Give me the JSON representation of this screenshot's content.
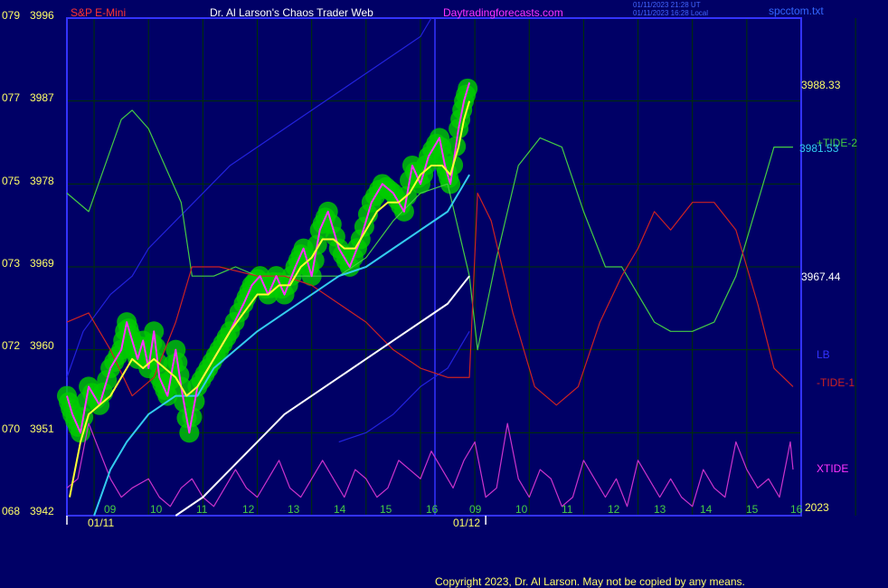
{
  "header": {
    "instrument": "S&P E-Mini",
    "author": "Dr. Al Larson's Chaos Trader Web",
    "website": "Daytradingforecasts.com",
    "timestamp_utc": "01/11/2023 21:28 UT",
    "timestamp_local": "01/11/2023 16:28 Local",
    "filename": "spcctom.txt"
  },
  "footer": {
    "copyright": "Copyright 2023, Dr. Al Larson. May not be copied by any means."
  },
  "right_labels": {
    "price_high": "3988.33",
    "price_mid": "3981.53",
    "price_low": "3967.44",
    "tide2": "+TIDE-2",
    "lb": "LB",
    "tide1": "-TIDE-1",
    "xtide": "XTIDE",
    "year": "2023"
  },
  "colors": {
    "background": "#000066",
    "frame": "#3333ff",
    "grid": "#003300",
    "price": "#ff33ff",
    "smooth": "#ffff33",
    "cyan": "#33ccee",
    "tide2": "#44cc44",
    "tide1": "#cc2222",
    "lb": "#2222dd",
    "xtide": "#cc33cc",
    "white_line": "#ffffff",
    "energy": "#00cc00"
  },
  "chart_data": {
    "type": "line",
    "title": "S&P E-Mini",
    "y_axis": {
      "range": [
        3942,
        3996
      ],
      "ticks": [
        {
          "left": "079",
          "right": "3996"
        },
        {
          "left": "077",
          "right": "3987"
        },
        {
          "left": "075",
          "right": "3978"
        },
        {
          "left": "073",
          "right": "3969"
        },
        {
          "left": "072",
          "right": "3960"
        },
        {
          "left": "070",
          "right": "3951"
        },
        {
          "left": "068",
          "right": "3942"
        }
      ]
    },
    "x_axis": {
      "hour_labels": [
        "09",
        "10",
        "11",
        "12",
        "13",
        "14",
        "15",
        "16",
        "09",
        "10",
        "11",
        "12",
        "13",
        "14",
        "15",
        "16"
      ],
      "date_labels": [
        "01/11",
        "01/12"
      ],
      "grid": true
    },
    "series": [
      {
        "key": "price",
        "points": [
          [
            8.5,
            3955
          ],
          [
            8.6,
            3953
          ],
          [
            8.75,
            3951
          ],
          [
            8.9,
            3956
          ],
          [
            9.1,
            3954
          ],
          [
            9.3,
            3958
          ],
          [
            9.5,
            3960
          ],
          [
            9.6,
            3963
          ],
          [
            9.7,
            3961
          ],
          [
            9.8,
            3959
          ],
          [
            9.9,
            3961
          ],
          [
            10.0,
            3958
          ],
          [
            10.1,
            3962
          ],
          [
            10.2,
            3957
          ],
          [
            10.35,
            3955
          ],
          [
            10.5,
            3960
          ],
          [
            10.6,
            3956
          ],
          [
            10.75,
            3951
          ],
          [
            10.9,
            3956
          ],
          [
            11.1,
            3958
          ],
          [
            11.3,
            3960
          ],
          [
            11.5,
            3962
          ],
          [
            11.75,
            3965
          ],
          [
            11.9,
            3967
          ],
          [
            12.05,
            3968
          ],
          [
            12.2,
            3966
          ],
          [
            12.35,
            3968
          ],
          [
            12.5,
            3966
          ],
          [
            12.7,
            3969
          ],
          [
            12.85,
            3971
          ],
          [
            13.0,
            3968
          ],
          [
            13.15,
            3973
          ],
          [
            13.3,
            3975
          ],
          [
            13.5,
            3971
          ],
          [
            13.7,
            3969
          ],
          [
            13.9,
            3972
          ],
          [
            14.1,
            3976
          ],
          [
            14.3,
            3978
          ],
          [
            14.5,
            3977
          ],
          [
            14.7,
            3975
          ],
          [
            14.85,
            3980
          ],
          [
            15.0,
            3978
          ],
          [
            15.15,
            3981
          ],
          [
            15.35,
            3983
          ],
          [
            15.45,
            3980
          ],
          [
            15.55,
            3978
          ],
          [
            15.7,
            3984
          ],
          [
            15.8,
            3987
          ],
          [
            15.9,
            3989
          ]
        ]
      },
      {
        "key": "smooth",
        "points": [
          [
            8.55,
            3944
          ],
          [
            8.75,
            3950
          ],
          [
            8.9,
            3953
          ],
          [
            9.1,
            3954
          ],
          [
            9.3,
            3955
          ],
          [
            9.5,
            3957
          ],
          [
            9.7,
            3959
          ],
          [
            9.9,
            3958
          ],
          [
            10.1,
            3959
          ],
          [
            10.3,
            3958
          ],
          [
            10.5,
            3957
          ],
          [
            10.7,
            3955
          ],
          [
            10.9,
            3956
          ],
          [
            11.1,
            3958
          ],
          [
            11.3,
            3960
          ],
          [
            11.5,
            3962
          ],
          [
            11.75,
            3964
          ],
          [
            12.0,
            3966
          ],
          [
            12.2,
            3966
          ],
          [
            12.4,
            3967
          ],
          [
            12.6,
            3967
          ],
          [
            12.8,
            3969
          ],
          [
            13.0,
            3970
          ],
          [
            13.2,
            3972
          ],
          [
            13.4,
            3972
          ],
          [
            13.6,
            3971
          ],
          [
            13.8,
            3971
          ],
          [
            14.0,
            3973
          ],
          [
            14.2,
            3975
          ],
          [
            14.4,
            3976
          ],
          [
            14.6,
            3976
          ],
          [
            14.8,
            3977
          ],
          [
            15.0,
            3979
          ],
          [
            15.2,
            3980
          ],
          [
            15.4,
            3980
          ],
          [
            15.55,
            3979
          ],
          [
            15.7,
            3982
          ],
          [
            15.8,
            3985
          ],
          [
            15.9,
            3987
          ]
        ]
      },
      {
        "key": "cyan",
        "points": [
          [
            9.0,
            3942
          ],
          [
            9.3,
            3947
          ],
          [
            9.6,
            3950
          ],
          [
            10.0,
            3953
          ],
          [
            10.5,
            3955
          ],
          [
            10.9,
            3955
          ],
          [
            11.2,
            3958
          ],
          [
            11.6,
            3960
          ],
          [
            12.0,
            3962
          ],
          [
            12.5,
            3964
          ],
          [
            13.0,
            3966
          ],
          [
            13.5,
            3968
          ],
          [
            14.0,
            3969
          ],
          [
            14.5,
            3971
          ],
          [
            15.0,
            3973
          ],
          [
            15.5,
            3975
          ],
          [
            15.9,
            3979
          ]
        ]
      },
      {
        "key": "white",
        "points": [
          [
            10.5,
            3942
          ],
          [
            11.0,
            3944
          ],
          [
            11.5,
            3947
          ],
          [
            12.0,
            3950
          ],
          [
            12.5,
            3953
          ],
          [
            13.0,
            3955
          ],
          [
            13.5,
            3957
          ],
          [
            14.0,
            3959
          ],
          [
            14.5,
            3961
          ],
          [
            15.0,
            3963
          ],
          [
            15.5,
            3965
          ],
          [
            15.9,
            3968
          ]
        ]
      },
      {
        "key": "lb",
        "points": [
          [
            8.5,
            3957
          ],
          [
            8.8,
            3962
          ],
          [
            9.3,
            3966
          ],
          [
            9.7,
            3968
          ],
          [
            10.0,
            3971
          ],
          [
            10.5,
            3974
          ],
          [
            11.0,
            3977
          ],
          [
            11.5,
            3980
          ],
          [
            12.0,
            3982
          ],
          [
            12.5,
            3984
          ],
          [
            13.0,
            3986
          ],
          [
            13.5,
            3988
          ],
          [
            14.0,
            3990
          ],
          [
            14.5,
            3992
          ],
          [
            15.0,
            3994
          ],
          [
            15.2,
            3996
          ]
        ],
        "end_points": [
          [
            13.5,
            3950
          ],
          [
            14.0,
            3951
          ],
          [
            14.5,
            3953
          ],
          [
            15.0,
            3956
          ],
          [
            15.5,
            3958
          ],
          [
            15.9,
            3962
          ]
        ]
      },
      {
        "key": "tide2",
        "points": [
          [
            8.5,
            3977
          ],
          [
            8.9,
            3975
          ],
          [
            9.2,
            3980
          ],
          [
            9.5,
            3985
          ],
          [
            9.7,
            3986
          ],
          [
            10.0,
            3984
          ],
          [
            10.3,
            3980
          ],
          [
            10.6,
            3976
          ],
          [
            10.8,
            3968
          ],
          [
            11.2,
            3968
          ],
          [
            11.6,
            3969
          ],
          [
            12.0,
            3968
          ],
          [
            12.5,
            3968
          ],
          [
            13.0,
            3968
          ],
          [
            13.5,
            3968
          ],
          [
            14.0,
            3970
          ],
          [
            14.5,
            3974
          ],
          [
            15.0,
            3977
          ],
          [
            15.5,
            3978
          ],
          [
            15.9,
            3968
          ],
          [
            16.05,
            3960
          ],
          [
            16.4,
            3970
          ],
          [
            16.8,
            3980
          ],
          [
            17.2,
            3983
          ],
          [
            17.6,
            3982
          ],
          [
            18.0,
            3975
          ],
          [
            18.4,
            3969
          ],
          [
            18.7,
            3969
          ],
          [
            19.0,
            3966
          ],
          [
            19.3,
            3963
          ],
          [
            19.6,
            3962
          ],
          [
            20.0,
            3962
          ],
          [
            20.4,
            3963
          ],
          [
            20.8,
            3968
          ],
          [
            21.2,
            3976
          ],
          [
            21.5,
            3982
          ],
          [
            21.85,
            3982
          ]
        ]
      },
      {
        "key": "tide1",
        "points": [
          [
            8.5,
            3963
          ],
          [
            8.9,
            3964
          ],
          [
            9.3,
            3960
          ],
          [
            9.7,
            3955
          ],
          [
            10.1,
            3957
          ],
          [
            10.5,
            3963
          ],
          [
            10.8,
            3969
          ],
          [
            11.3,
            3969
          ],
          [
            12.0,
            3968
          ],
          [
            12.5,
            3968
          ],
          [
            13.0,
            3967
          ],
          [
            13.5,
            3965
          ],
          [
            14.0,
            3963
          ],
          [
            14.5,
            3960
          ],
          [
            15.0,
            3958
          ],
          [
            15.5,
            3957
          ],
          [
            15.9,
            3957
          ],
          [
            16.05,
            3977
          ],
          [
            16.3,
            3974
          ],
          [
            16.7,
            3964
          ],
          [
            17.1,
            3956
          ],
          [
            17.5,
            3954
          ],
          [
            17.9,
            3956
          ],
          [
            18.3,
            3963
          ],
          [
            18.7,
            3968
          ],
          [
            19.0,
            3971
          ],
          [
            19.3,
            3975
          ],
          [
            19.6,
            3973
          ],
          [
            20.0,
            3976
          ],
          [
            20.4,
            3976
          ],
          [
            20.8,
            3973
          ],
          [
            21.2,
            3965
          ],
          [
            21.5,
            3958
          ],
          [
            21.85,
            3956
          ]
        ]
      },
      {
        "key": "xtide",
        "points": [
          [
            8.5,
            3945
          ],
          [
            8.7,
            3946
          ],
          [
            8.9,
            3952
          ],
          [
            9.1,
            3949
          ],
          [
            9.3,
            3946
          ],
          [
            9.5,
            3944
          ],
          [
            9.7,
            3945
          ],
          [
            10.0,
            3946
          ],
          [
            10.2,
            3944
          ],
          [
            10.4,
            3943
          ],
          [
            10.6,
            3945
          ],
          [
            10.8,
            3946
          ],
          [
            11.0,
            3944
          ],
          [
            11.2,
            3943
          ],
          [
            11.4,
            3945
          ],
          [
            11.6,
            3947
          ],
          [
            11.8,
            3945
          ],
          [
            12.0,
            3944
          ],
          [
            12.2,
            3946
          ],
          [
            12.4,
            3948
          ],
          [
            12.6,
            3945
          ],
          [
            12.8,
            3944
          ],
          [
            13.0,
            3946
          ],
          [
            13.2,
            3948
          ],
          [
            13.4,
            3946
          ],
          [
            13.6,
            3944
          ],
          [
            13.8,
            3947
          ],
          [
            14.0,
            3946
          ],
          [
            14.2,
            3944
          ],
          [
            14.4,
            3945
          ],
          [
            14.6,
            3948
          ],
          [
            14.8,
            3947
          ],
          [
            15.0,
            3946
          ],
          [
            15.2,
            3949
          ],
          [
            15.4,
            3947
          ],
          [
            15.6,
            3945
          ],
          [
            15.8,
            3948
          ],
          [
            16.0,
            3950
          ],
          [
            16.2,
            3944
          ],
          [
            16.4,
            3945
          ],
          [
            16.6,
            3952
          ],
          [
            16.8,
            3946
          ],
          [
            17.0,
            3944
          ],
          [
            17.2,
            3947
          ],
          [
            17.4,
            3946
          ],
          [
            17.6,
            3943
          ],
          [
            17.8,
            3944
          ],
          [
            18.0,
            3948
          ],
          [
            18.2,
            3946
          ],
          [
            18.4,
            3944
          ],
          [
            18.6,
            3946
          ],
          [
            18.8,
            3943
          ],
          [
            19.0,
            3948
          ],
          [
            19.2,
            3946
          ],
          [
            19.4,
            3944
          ],
          [
            19.6,
            3946
          ],
          [
            19.8,
            3944
          ],
          [
            20.0,
            3943
          ],
          [
            20.2,
            3947
          ],
          [
            20.4,
            3945
          ],
          [
            20.6,
            3944
          ],
          [
            20.8,
            3950
          ],
          [
            21.0,
            3947
          ],
          [
            21.2,
            3945
          ],
          [
            21.4,
            3946
          ],
          [
            21.6,
            3944
          ],
          [
            21.8,
            3950
          ],
          [
            21.85,
            3947
          ]
        ]
      }
    ]
  }
}
